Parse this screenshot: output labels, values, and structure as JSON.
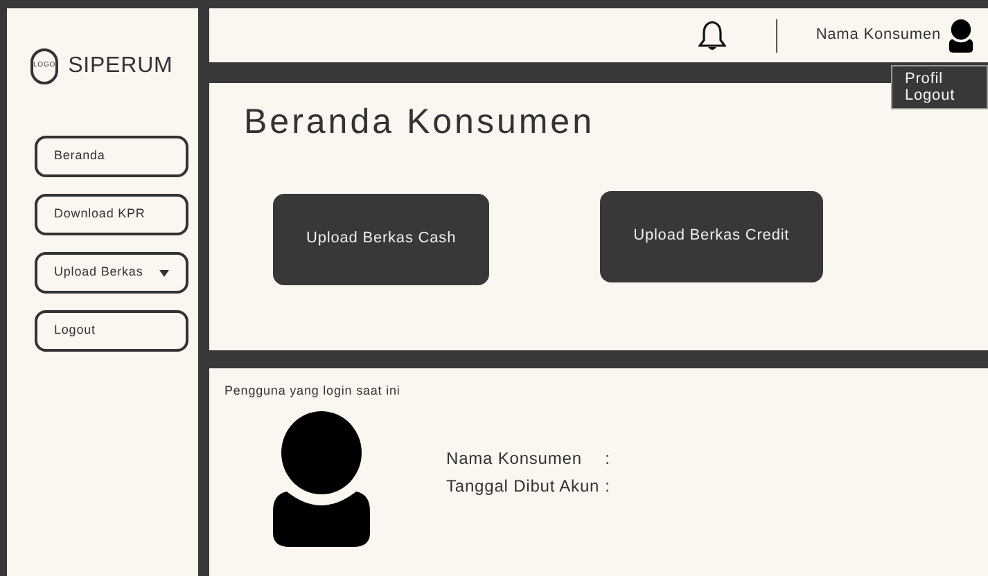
{
  "sidebar": {
    "logo_text": "LOGO",
    "brand": "SIPERUM",
    "items": [
      {
        "label": "Beranda",
        "kind": "link"
      },
      {
        "label": "Download KPR",
        "kind": "link"
      },
      {
        "label": "Upload Berkas",
        "kind": "dropdown"
      },
      {
        "label": "Logout",
        "kind": "link"
      }
    ]
  },
  "topbar": {
    "user_name": "Nama Konsumen",
    "menu": [
      "Profil",
      "Logout"
    ]
  },
  "page_title": "Beranda Konsumen",
  "actions": [
    "Upload Berkas Cash",
    "Upload Berkas Credit"
  ],
  "current_user": {
    "caption": "Pengguna yang login saat ini",
    "fields": [
      {
        "label": "Nama Konsumen",
        "separator": ":"
      },
      {
        "label": "Tanggal Dibut Akun",
        "separator": ":"
      }
    ]
  }
}
